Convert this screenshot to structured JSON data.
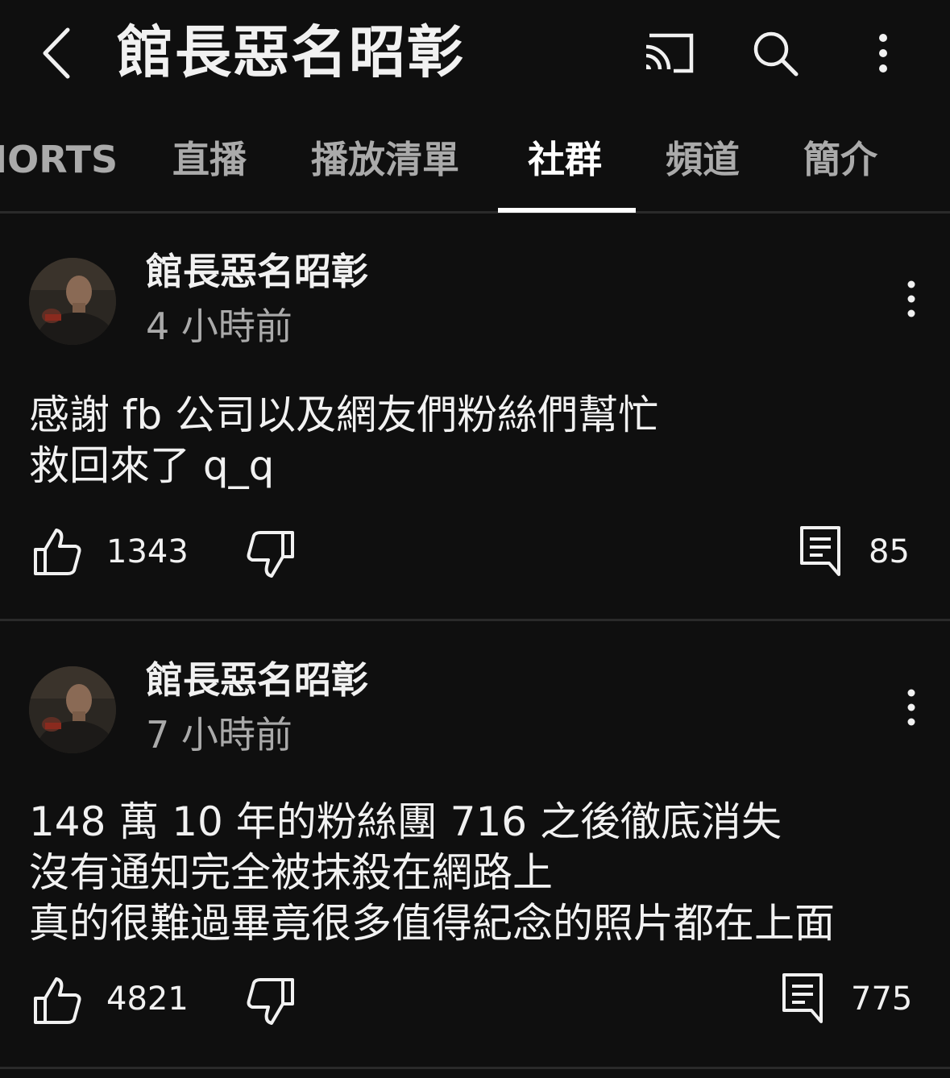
{
  "header": {
    "title": "館長惡名昭彰",
    "back_icon": "chevron-left-icon",
    "cast_icon": "cast-icon",
    "search_icon": "search-icon",
    "more_icon": "more-vert-icon"
  },
  "tabs": [
    {
      "label": "IORTS"
    },
    {
      "label": "直播"
    },
    {
      "label": "播放清單"
    },
    {
      "label": "社群",
      "active": true
    },
    {
      "label": "頻道"
    },
    {
      "label": "簡介"
    }
  ],
  "posts": [
    {
      "author": "館長惡名昭彰",
      "time": "4 小時前",
      "lines": [
        "感謝 fb 公司以及網友們粉絲們幫忙",
        "救回來了 q_q"
      ],
      "likes": "1343",
      "comments": "85"
    },
    {
      "author": "館長惡名昭彰",
      "time": "7 小時前",
      "lines": [
        "148 萬 10 年的粉絲團 716 之後徹底消失",
        "沒有通知完全被抹殺在網路上",
        "真的很難過畢竟很多值得紀念的照片都在上面"
      ],
      "likes": "4821",
      "comments": "775"
    }
  ],
  "colors": {
    "background": "#0f0f0f",
    "text_primary": "#f1f1f1",
    "text_secondary": "#aaaaaa",
    "divider": "#2a2a2a"
  }
}
